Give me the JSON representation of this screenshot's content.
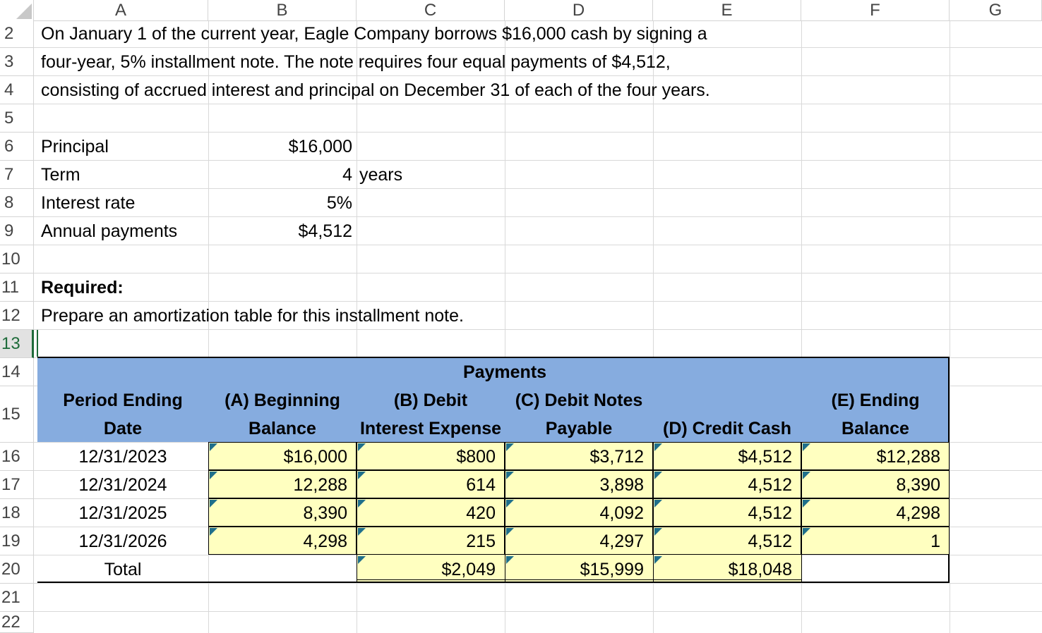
{
  "columns": [
    "A",
    "B",
    "C",
    "D",
    "E",
    "F",
    "G"
  ],
  "rows": [
    "2",
    "3",
    "4",
    "5",
    "6",
    "7",
    "8",
    "9",
    "10",
    "11",
    "12",
    "13",
    "14",
    "15",
    "16",
    "17",
    "18",
    "19",
    "20",
    "21",
    "22"
  ],
  "intro": [
    "On January 1 of the current year, Eagle Company borrows $16,000 cash by signing a",
    "four-year, 5% installment note. The note requires four equal payments of $4,512,",
    "consisting of accrued interest and principal on December 31 of each of the four years."
  ],
  "inputs": {
    "principal_label": "Principal",
    "principal_value": "$16,000",
    "term_label": "Term",
    "term_value": "4",
    "term_unit": "years",
    "rate_label": "Interest rate",
    "rate_value": "5%",
    "payment_label": "Annual payments",
    "payment_value": "$4,512"
  },
  "required_label": "Required:",
  "required_text": "Prepare an amortization table for this installment note.",
  "table": {
    "payments_header": "Payments",
    "col_a": [
      "Period Ending",
      "Date"
    ],
    "col_b": [
      "(A) Beginning",
      "Balance"
    ],
    "col_c": [
      "(B) Debit",
      "Interest Expense"
    ],
    "col_d": [
      "(C) Debit Notes",
      "Payable"
    ],
    "col_e": "(D) Credit Cash",
    "col_f": [
      "(E) Ending",
      "Balance"
    ],
    "rows": [
      {
        "date": "12/31/2023",
        "beg": "$16,000",
        "int": "$800",
        "notes": "$3,712",
        "cash": "$4,512",
        "end": "$12,288"
      },
      {
        "date": "12/31/2024",
        "beg": "12,288",
        "int": "614",
        "notes": "3,898",
        "cash": "4,512",
        "end": "8,390"
      },
      {
        "date": "12/31/2025",
        "beg": "8,390",
        "int": "420",
        "notes": "4,092",
        "cash": "4,512",
        "end": "4,298"
      },
      {
        "date": "12/31/2026",
        "beg": "4,298",
        "int": "215",
        "notes": "4,297",
        "cash": "4,512",
        "end": "1"
      }
    ],
    "total_label": "Total",
    "total_int": "$2,049",
    "total_notes": "$15,999",
    "total_cash": "$18,048"
  },
  "colors": {
    "header_band": "#86acdf",
    "input_fill": "#ffffc0",
    "indicator": "#1f6f8b",
    "selected": "#1e6b3a"
  }
}
